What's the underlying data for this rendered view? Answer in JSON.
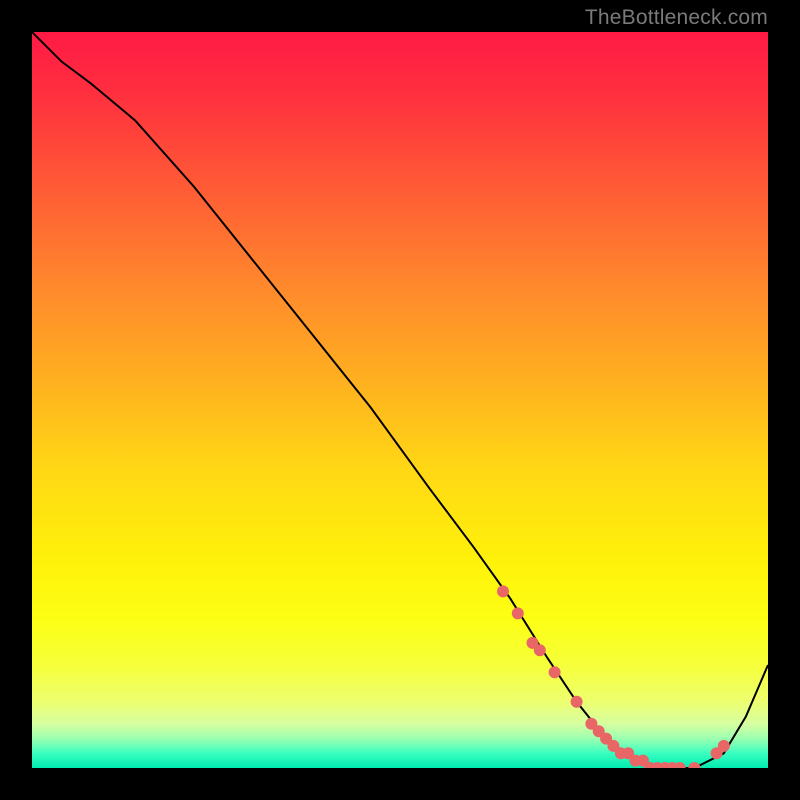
{
  "watermark": "TheBottleneck.com",
  "colors": {
    "dot": "#e96666",
    "curve": "#000000"
  },
  "chart_data": {
    "type": "line",
    "title": "",
    "xlabel": "",
    "ylabel": "",
    "xlim": [
      0,
      100
    ],
    "ylim": [
      0,
      100
    ],
    "grid": false,
    "legend": false,
    "series": [
      {
        "name": "bottleneck-curve",
        "x": [
          0,
          4,
          8,
          14,
          22,
          30,
          38,
          46,
          54,
          60,
          65,
          70,
          74,
          78,
          82,
          86,
          90,
          94,
          97,
          100
        ],
        "y": [
          100,
          96,
          93,
          88,
          79,
          69,
          59,
          49,
          38,
          30,
          23,
          15,
          9,
          4,
          1,
          0,
          0,
          2,
          7,
          14
        ]
      }
    ],
    "highlight_points": {
      "name": "dots",
      "x": [
        64,
        66,
        68,
        69,
        71,
        74,
        76,
        77,
        78,
        79,
        80,
        81,
        82,
        83,
        84,
        85,
        86,
        87,
        88,
        90,
        93,
        94
      ],
      "y": [
        24,
        21,
        17,
        16,
        13,
        9,
        6,
        5,
        4,
        3,
        2,
        2,
        1,
        1,
        0,
        0,
        0,
        0,
        0,
        0,
        2,
        3
      ]
    }
  }
}
